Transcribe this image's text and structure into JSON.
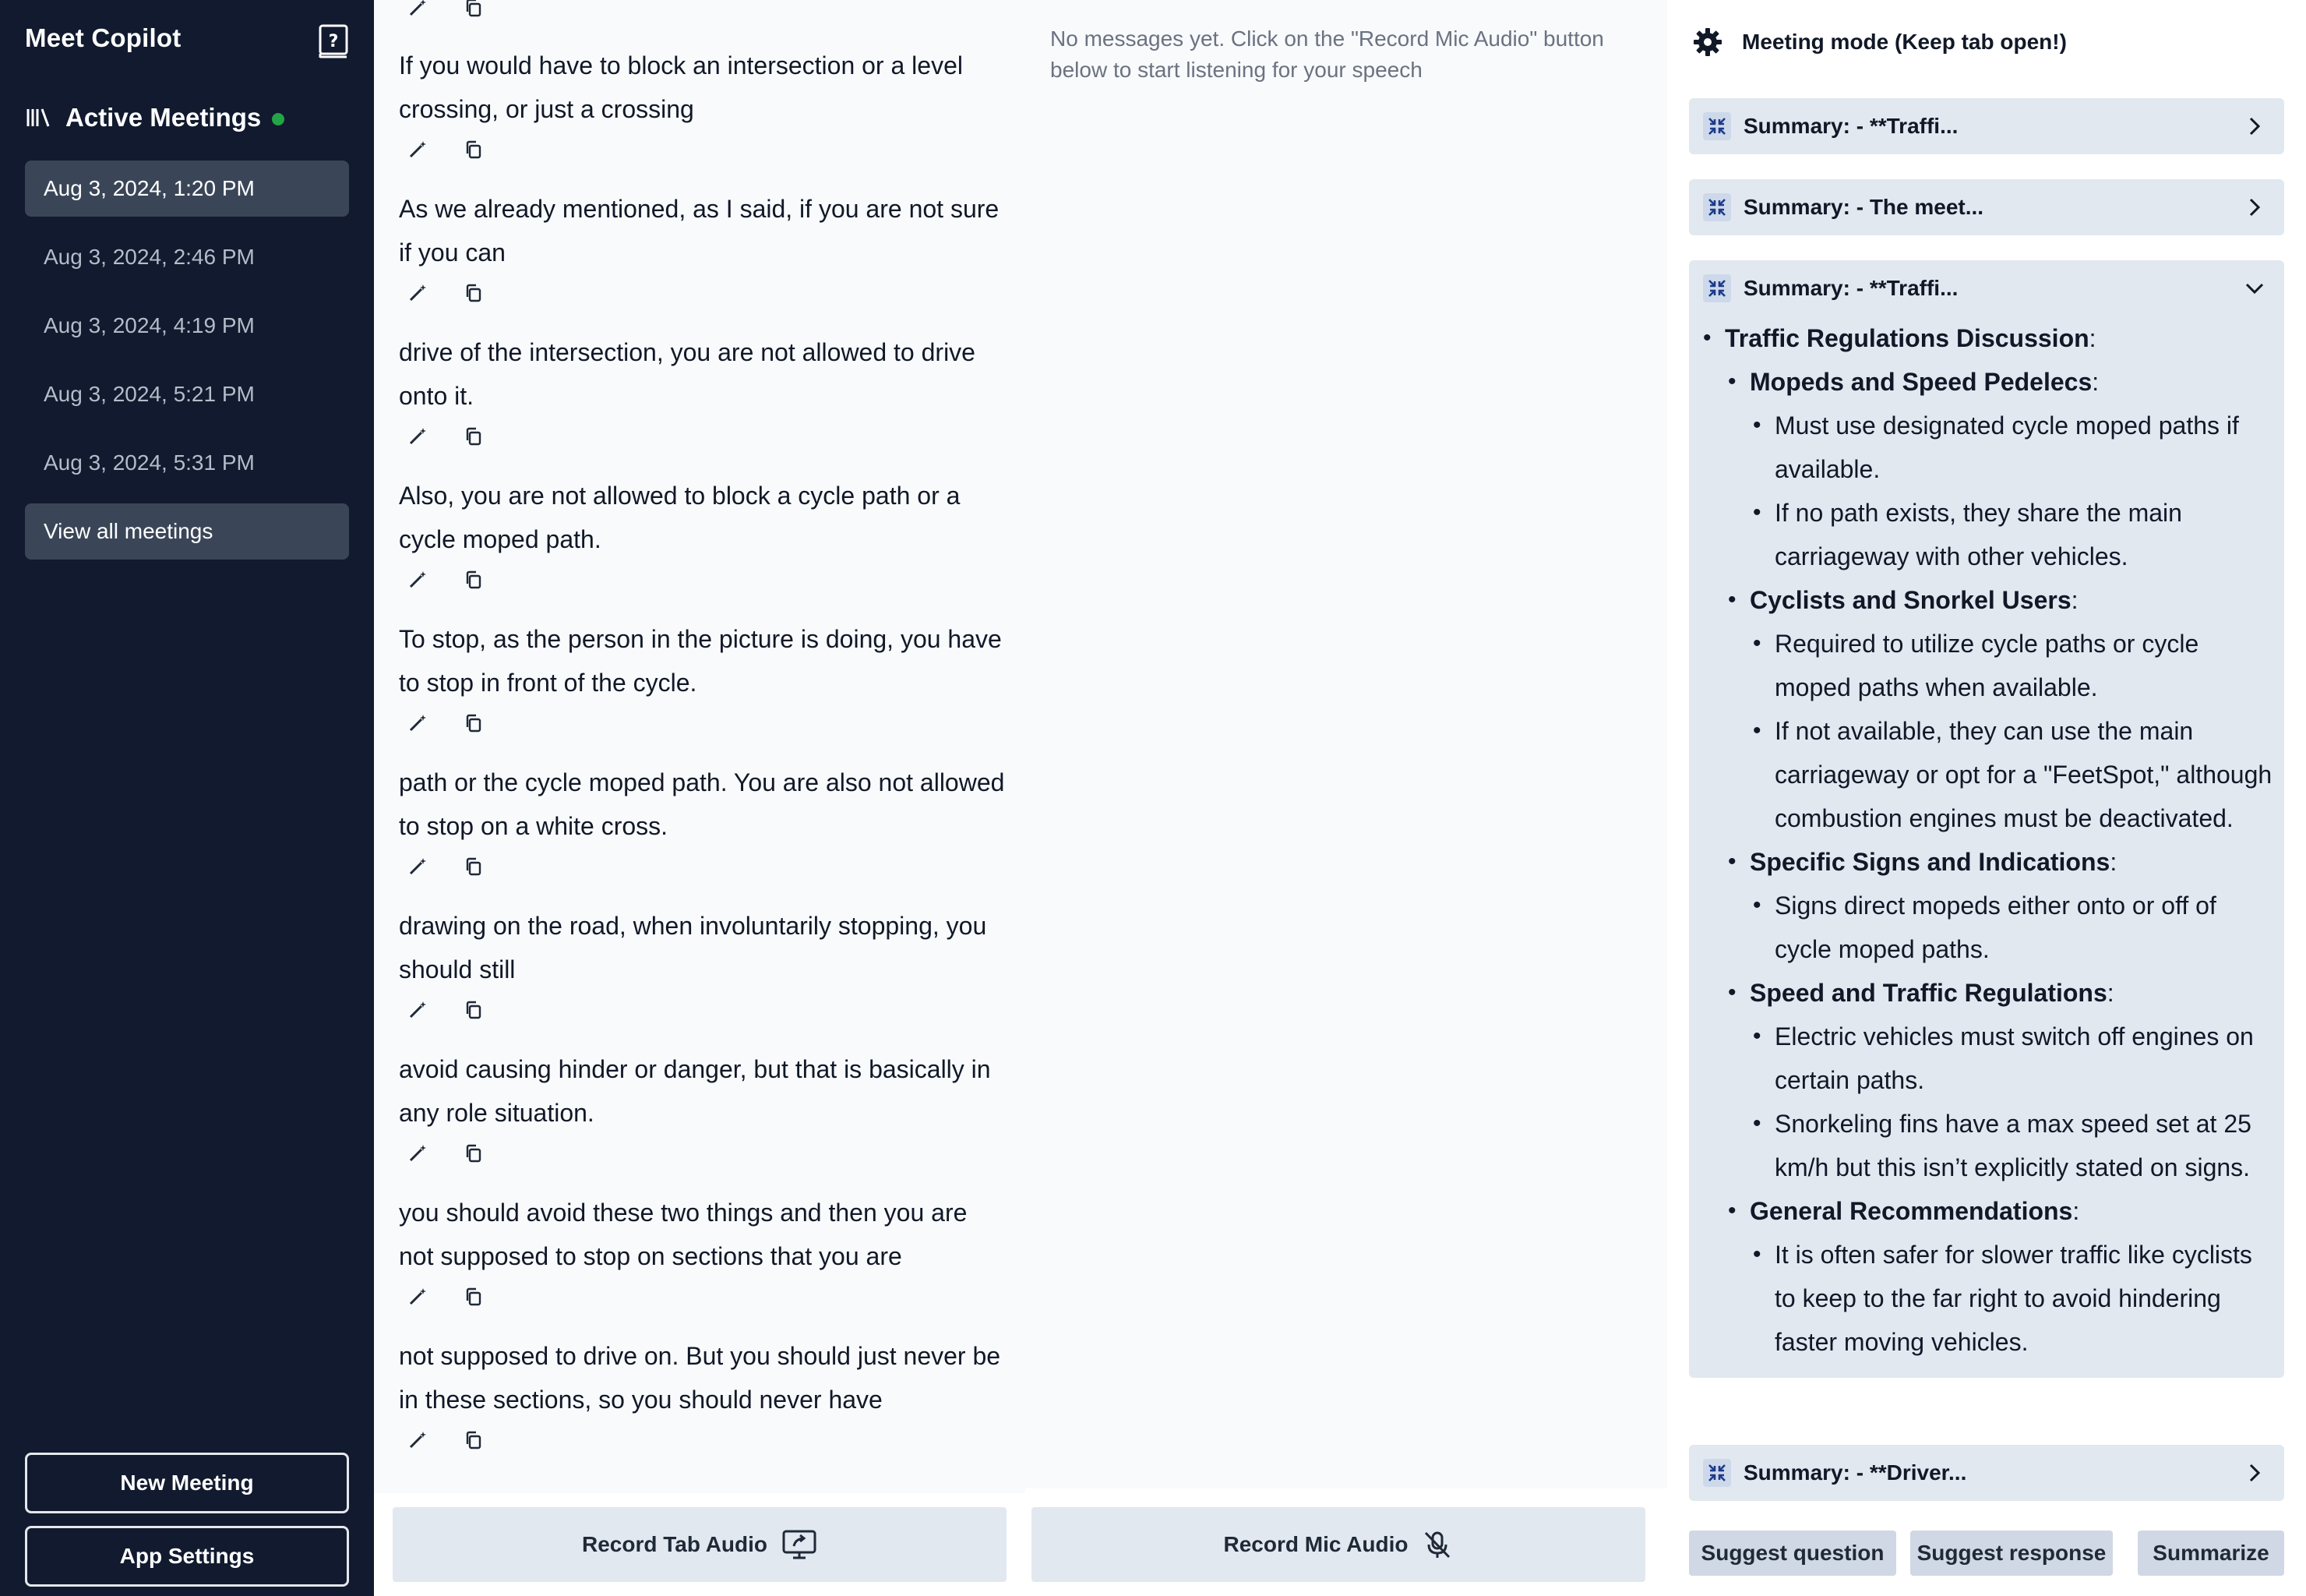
{
  "sidebar": {
    "app_title": "Meet Copilot",
    "section_label": "Active Meetings",
    "meetings": [
      {
        "label": "Aug 3, 2024, 1:20 PM",
        "active": true
      },
      {
        "label": "Aug 3, 2024, 2:46 PM",
        "active": false
      },
      {
        "label": "Aug 3, 2024, 4:19 PM",
        "active": false
      },
      {
        "label": "Aug 3, 2024, 5:21 PM",
        "active": false
      },
      {
        "label": "Aug 3, 2024, 5:31 PM",
        "active": false
      }
    ],
    "view_all_label": "View all meetings",
    "new_meeting_label": "New Meeting",
    "app_settings_label": "App Settings",
    "status_dot_color": "#22a447"
  },
  "transcript": {
    "entries": [
      {
        "text": "If you would have to block an intersection or a level crossing, or just a crossing"
      },
      {
        "text": "As we already mentioned, as I said, if you are not sure if you can"
      },
      {
        "text": "drive of the intersection, you are not allowed to drive onto it."
      },
      {
        "text": "Also, you are not allowed to block a cycle path or a cycle moped path."
      },
      {
        "text": "To stop, as the person in the picture is doing, you have to stop in front of the cycle."
      },
      {
        "text": "path or the cycle moped path. You are also not allowed to stop on a white cross."
      },
      {
        "text": "drawing on the road, when involuntarily stopping, you should still"
      },
      {
        "text": "avoid causing hinder or danger, but that is basically in any role situation."
      },
      {
        "text": "you should avoid these two things and then you are not supposed to stop on sections that you are"
      },
      {
        "text": "not supposed to drive on. But you should just never be in these sections, so you should never have"
      }
    ],
    "action_icons": [
      "magic-wand-icon",
      "copy-icon"
    ]
  },
  "mic_panel": {
    "empty_message": "No messages yet. Click on the \"Record Mic Audio\" button below to start listening for your speech"
  },
  "record_buttons": {
    "tab_label": "Record Tab Audio",
    "mic_label": "Record Mic Audio"
  },
  "right_panel": {
    "mode_label": "Meeting mode (Keep tab open!)",
    "summaries": [
      {
        "title": "Summary: - **Traffi...",
        "expanded": false
      },
      {
        "title": "Summary: - The meet...",
        "expanded": false
      },
      {
        "title": "Summary: - **Traffi...",
        "expanded": true
      },
      {
        "title": "Summary: - **Driver...",
        "expanded": false
      }
    ],
    "expanded_summary": {
      "topic": "Traffic Regulations Discussion",
      "sections": [
        {
          "heading": "Mopeds and Speed Pedelecs",
          "points": [
            "Must use designated cycle moped paths if available.",
            "If no path exists, they share the main carriageway with other vehicles."
          ]
        },
        {
          "heading": "Cyclists and Snorkel Users",
          "points": [
            "Required to utilize cycle paths or cycle moped paths when available.",
            "If not available, they can use the main carriageway or opt for a \"FeetSpot,\" although combustion engines must be deactivated."
          ]
        },
        {
          "heading": "Specific Signs and Indications",
          "points": [
            "Signs direct mopeds either onto or off of cycle moped paths."
          ]
        },
        {
          "heading": "Speed and Traffic Regulations",
          "points": [
            "Electric vehicles must switch off engines on certain paths.",
            "Snorkeling fins have a max speed set at 25 km/h but this isn’t explicitly stated on signs."
          ]
        },
        {
          "heading": "General Recommendations",
          "points": [
            "It is often safer for slower traffic like cyclists to keep to the far right to avoid hindering faster moving vehicles."
          ]
        }
      ]
    },
    "actions": {
      "suggest_question": "Suggest question",
      "suggest_response": "Suggest response",
      "summarize": "Summarize"
    }
  },
  "colors": {
    "sidebar_bg": "#111a2e",
    "active_item_bg": "#3a4658",
    "panel_bg": "#f8fafc",
    "card_bg": "#e2e8f0",
    "accent_icon": "#1e3a8a"
  }
}
